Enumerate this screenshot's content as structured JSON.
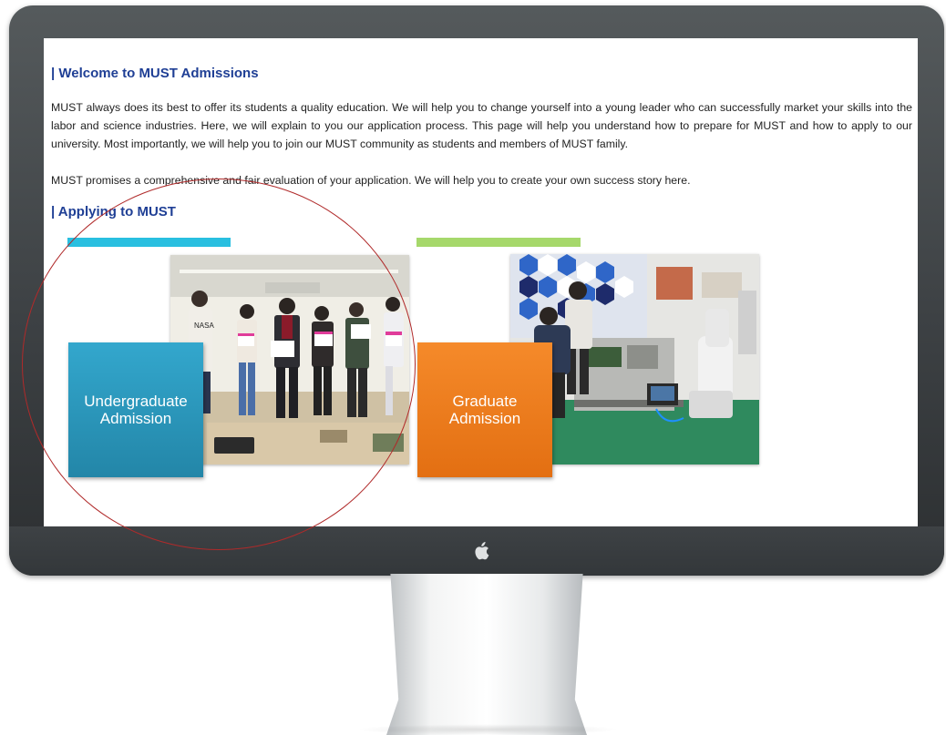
{
  "welcome": {
    "heading": "| Welcome to MUST Admissions",
    "paragraph1": "MUST always does its best to offer its students a quality education. We will help you to change yourself into a young leader who can successfully market your skills into the labor and science industries.  Here, we will explain to you our application process. This page will help you understand how to prepare for MUST and how to apply to our university. Most importantly, we will help you to join our MUST community as students and members of MUST family.",
    "paragraph2": "MUST promises a comprehensive and fair evaluation of your application. We will help you to create your own success story here."
  },
  "applying": {
    "heading": "| Applying to MUST",
    "undergraduate": {
      "label": "Undergraduate Admission",
      "bar_color": "#29bfe0",
      "tile_color": "#2a97bd",
      "shirt_text": "NASA"
    },
    "graduate": {
      "label": "Graduate Admission",
      "bar_color": "#a6d86b",
      "tile_color": "#f08022"
    }
  },
  "colors": {
    "heading": "#1f3f95",
    "annotation_circle": "#b02a2a",
    "monitor_bezel": "#3d4144"
  },
  "icons": {
    "monitor_logo": "apple-logo-icon"
  }
}
